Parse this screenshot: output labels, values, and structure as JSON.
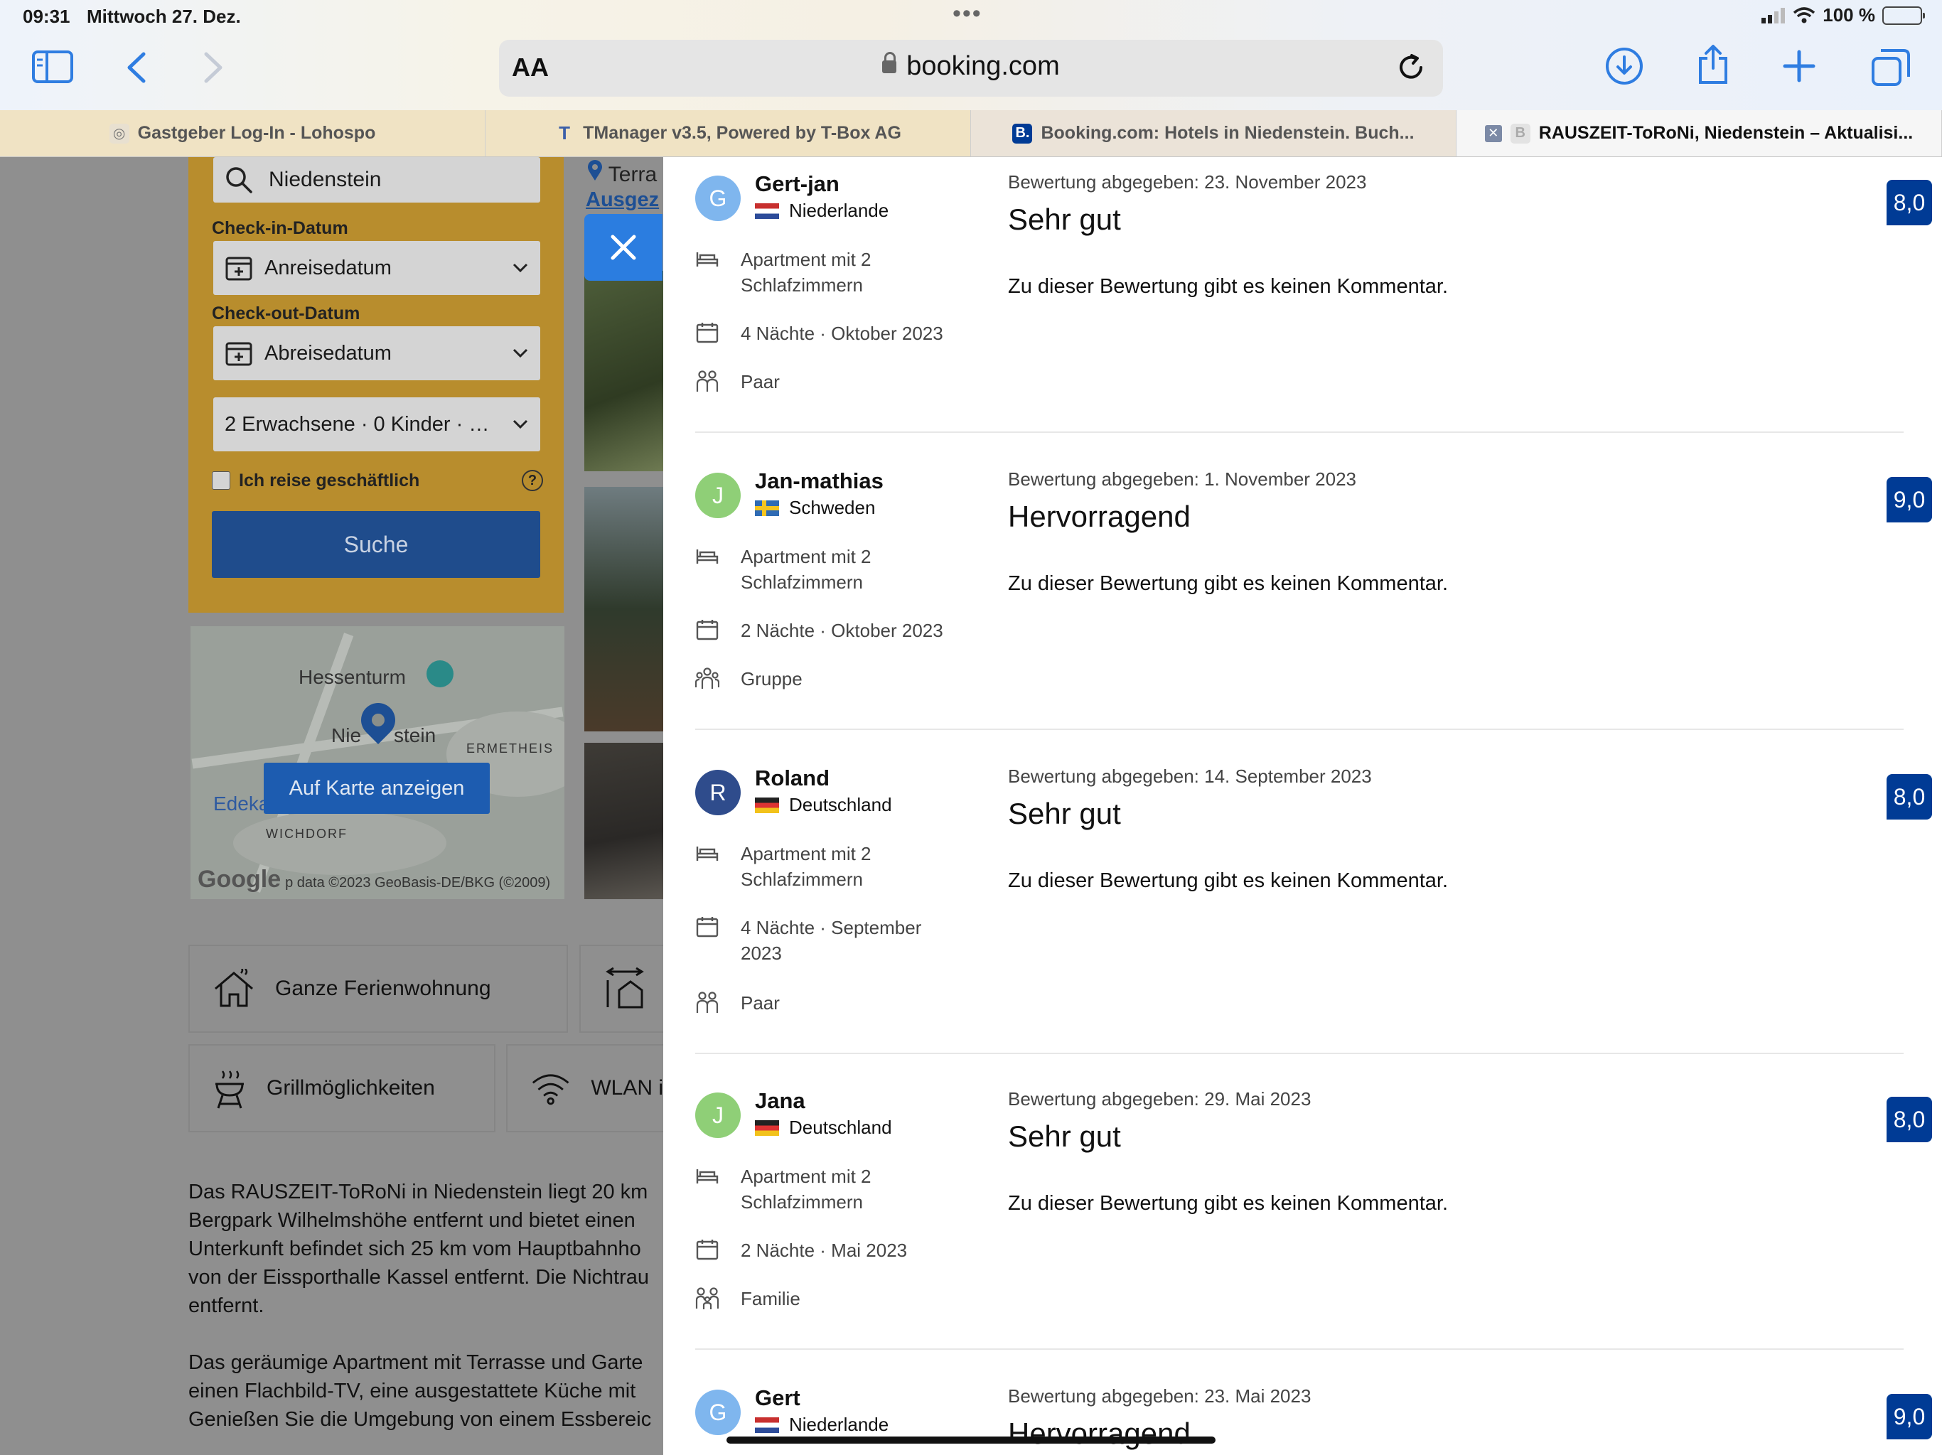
{
  "status": {
    "time": "09:31",
    "date": "Mittwoch 27. Dez.",
    "battery": "100 %"
  },
  "toolbar": {
    "reader_label": "AA",
    "url": "booking.com"
  },
  "tabs": [
    {
      "label": "Gastgeber Log-In - Lohospo",
      "icon": "lohospo-icon"
    },
    {
      "label": "TManager v3.5, Powered by T-Box AG",
      "icon": "tbox-icon"
    },
    {
      "label": "Booking.com: Hotels in Niedenstein. Buch...",
      "icon": "booking-icon"
    },
    {
      "label": "RAUSZEIT-ToRoNi, Niedenstein – Aktualisi...",
      "icon": "booking-icon"
    }
  ],
  "search": {
    "destination": "Niedenstein",
    "checkin_label": "Check-in-Datum",
    "checkin_value": "Anreisedatum",
    "checkout_label": "Check-out-Datum",
    "checkout_value": "Abreisedatum",
    "guests": "2 Erwachsene · 0 Kinder · 1 ...",
    "business": "Ich reise geschäftlich",
    "search_button": "Suche"
  },
  "map": {
    "label_hessenturm": "Hessenturm",
    "label_town_a": "Nie",
    "label_town_b": "stein",
    "label_ermetheis": "ERMETHEIS",
    "label_edeka": "Edeka",
    "label_wichdorf": "WICHDORF",
    "show_button": "Auf Karte anzeigen",
    "logo": "Google",
    "attribution": "p data ©2023 GeoBasis-DE/BKG (©2009)"
  },
  "gallery": {
    "terrace": "Terra",
    "highlight": "Ausgez"
  },
  "facilities": [
    {
      "label": "Ganze Ferienwohnung",
      "icon": "house-icon"
    },
    {
      "label": "",
      "icon": "size-icon"
    },
    {
      "label": "Grillmöglichkeiten",
      "icon": "grill-icon"
    },
    {
      "label": "WLAN i",
      "icon": "wifi-icon"
    }
  ],
  "description": {
    "p1": [
      "Das RAUSZEIT-ToRoNi in Niedenstein liegt 20 km",
      "Bergpark Wilhelmshöhe entfernt und bietet einen",
      "Unterkunft befindet sich 25 km vom Hauptbahnho",
      "von der Eissporthalle Kassel entfernt. Die Nichtrau",
      "entfernt."
    ],
    "p2": [
      "Das geräumige Apartment mit Terrasse und Garte",
      "einen Flachbild-TV, eine ausgestattete Küche mit",
      "Genießen Sie die Umgebung von einem Essbereic"
    ]
  },
  "colors": {
    "brand_blue": "#003b95",
    "accent_blue": "#2f7de1",
    "search_yellow": "#b88d2d"
  },
  "reviews": [
    {
      "initial": "G",
      "avatar_color": "#7fb6ee",
      "name": "Gert-jan",
      "country": "Niederlande",
      "flag": "nl",
      "room": "Apartment mit 2 Schlafzimmern",
      "stay": "4 Nächte · Oktober 2023",
      "group": "Paar",
      "date": "Bewertung abgegeben: 23. November 2023",
      "title": "Sehr gut",
      "comment": "Zu dieser Bewertung gibt es keinen Kommentar.",
      "score": "8,0"
    },
    {
      "initial": "J",
      "avatar_color": "#8fcf77",
      "name": "Jan-mathias",
      "country": "Schweden",
      "flag": "se",
      "room": "Apartment mit 2 Schlafzimmern",
      "stay": "2 Nächte · Oktober 2023",
      "group": "Gruppe",
      "date": "Bewertung abgegeben: 1. November 2023",
      "title": "Hervorragend",
      "comment": "Zu dieser Bewertung gibt es keinen Kommentar.",
      "score": "9,0"
    },
    {
      "initial": "R",
      "avatar_color": "#2f4c8c",
      "name": "Roland",
      "country": "Deutschland",
      "flag": "de",
      "room": "Apartment mit 2 Schlafzimmern",
      "stay": "4 Nächte · September 2023",
      "group": "Paar",
      "date": "Bewertung abgegeben: 14. September 2023",
      "title": "Sehr gut",
      "comment": "Zu dieser Bewertung gibt es keinen Kommentar.",
      "score": "8,0"
    },
    {
      "initial": "J",
      "avatar_color": "#8fcf77",
      "name": "Jana",
      "country": "Deutschland",
      "flag": "de",
      "room": "Apartment mit 2 Schlafzimmern",
      "stay": "2 Nächte · Mai 2023",
      "group": "Familie",
      "date": "Bewertung abgegeben: 29. Mai 2023",
      "title": "Sehr gut",
      "comment": "Zu dieser Bewertung gibt es keinen Kommentar.",
      "score": "8,0"
    },
    {
      "initial": "G",
      "avatar_color": "#7fb6ee",
      "name": "Gert",
      "country": "Niederlande",
      "flag": "nl",
      "room": "",
      "stay": "",
      "group": "",
      "date": "Bewertung abgegeben: 23. Mai 2023",
      "title": "Hervorragend",
      "comment": "",
      "score": "9,0"
    }
  ]
}
